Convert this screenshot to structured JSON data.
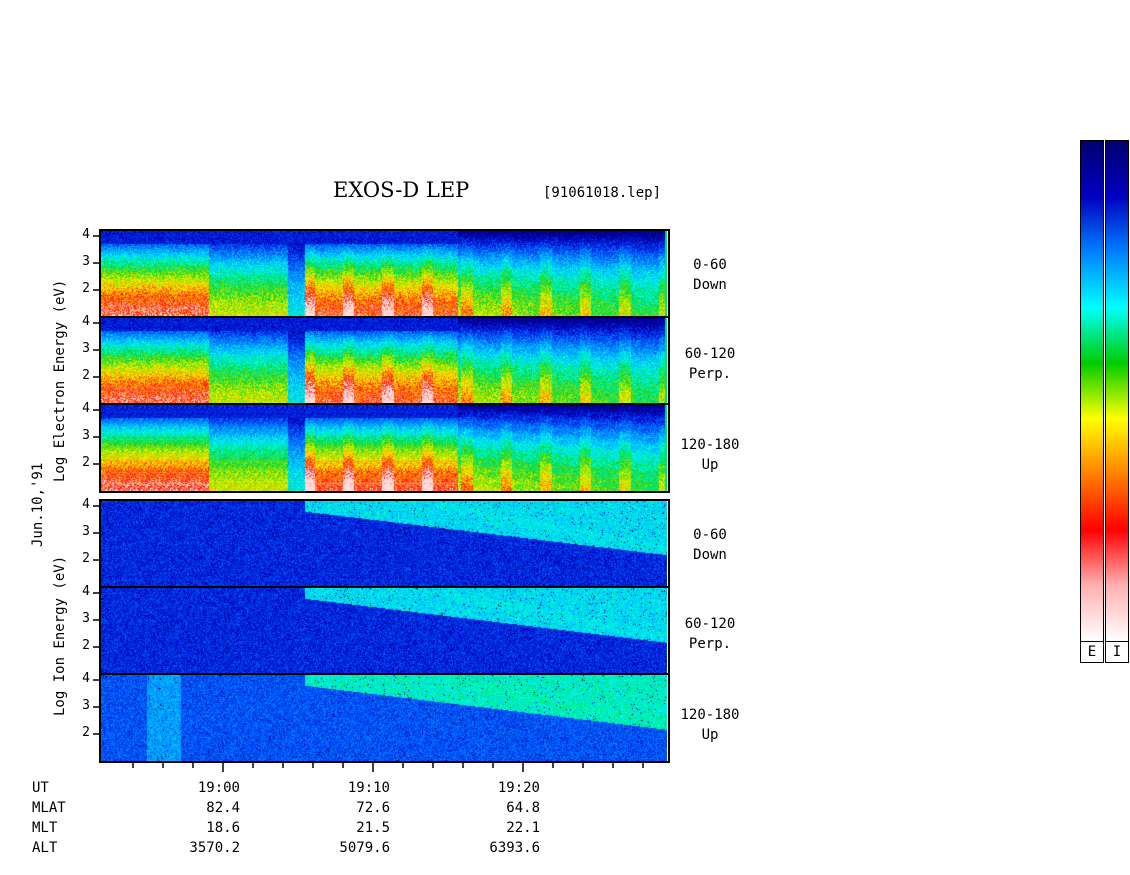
{
  "header": {
    "title": "EXOS-D LEP",
    "file_tag": "[91061018.lep]"
  },
  "side_labels": {
    "electron": "Log Electron Energy (eV)",
    "ion": "Log Ion Energy (eV)",
    "date": "Jun.10,'91"
  },
  "panels": [
    {
      "species": "electron",
      "range": "0-60",
      "dir": "Down"
    },
    {
      "species": "electron",
      "range": "60-120",
      "dir": "Perp."
    },
    {
      "species": "electron",
      "range": "120-180",
      "dir": "Up"
    },
    {
      "species": "ion",
      "range": "0-60",
      "dir": "Down"
    },
    {
      "species": "ion",
      "range": "60-120",
      "dir": "Perp."
    },
    {
      "species": "ion",
      "range": "120-180",
      "dir": "Up"
    }
  ],
  "colorbar": {
    "labels": [
      "E",
      "I"
    ],
    "colors": [
      "#ffffff",
      "#ffb0b0",
      "#ff0000",
      "#ff8000",
      "#ffff00",
      "#00cc00",
      "#00ffff",
      "#0080ff",
      "#0000c0",
      "#000070"
    ]
  },
  "footer": {
    "rows": [
      {
        "label": "UT",
        "values": [
          "19:00",
          "19:10",
          "19:20"
        ]
      },
      {
        "label": "MLAT",
        "values": [
          "82.4",
          "72.6",
          "64.8"
        ]
      },
      {
        "label": "MLT",
        "values": [
          "18.6",
          "21.5",
          "22.1"
        ]
      },
      {
        "label": "ALT",
        "values": [
          "3570.2",
          "5079.6",
          "6393.6"
        ]
      }
    ]
  },
  "chart_data": {
    "type": "heatmap",
    "title": "EXOS-D LEP",
    "xlabel": "UT",
    "ylabel": "Log Energy (eV)",
    "y_ticks": [
      "4",
      "3",
      "2"
    ],
    "x_ticks": [
      "19:00",
      "19:10",
      "19:20"
    ],
    "x_minutes_range": [
      18.9,
      19.55
    ],
    "series": [
      {
        "name": "Electron 0-60 Down"
      },
      {
        "name": "Electron 60-120 Perp."
      },
      {
        "name": "Electron 120-180 Up"
      },
      {
        "name": "Ion 0-60 Down"
      },
      {
        "name": "Ion 60-120 Perp."
      },
      {
        "name": "Ion 120-180 Up"
      }
    ]
  }
}
